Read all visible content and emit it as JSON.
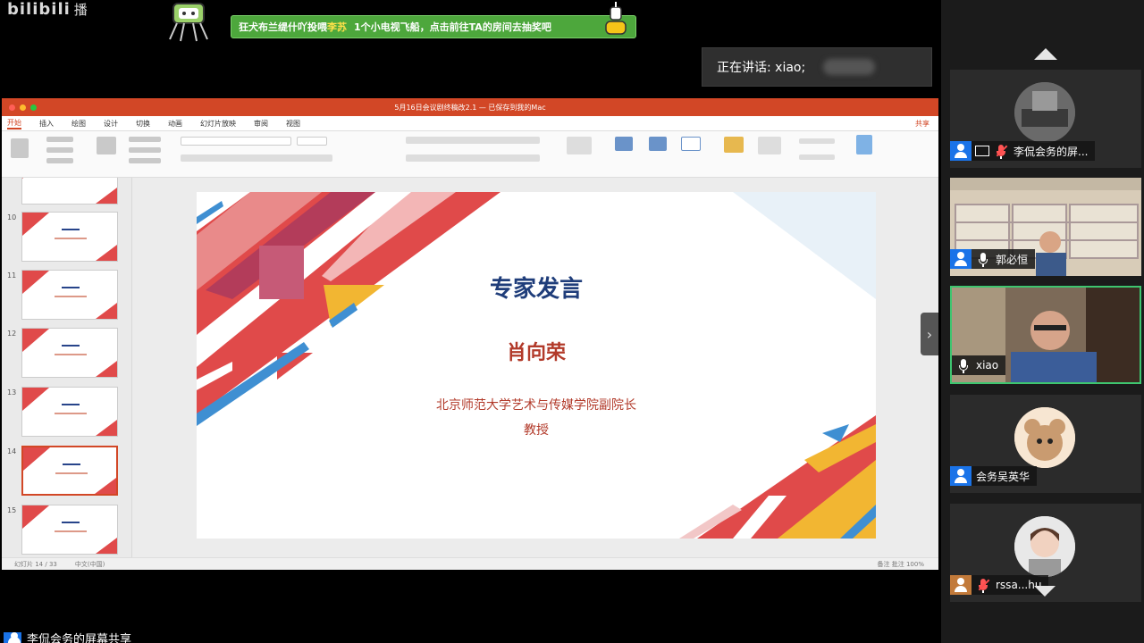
{
  "stream": {
    "logo_text": "bilibili",
    "logo_sub": "播",
    "banner_part1": "狂犬布兰缇什吖投喂",
    "banner_highlight": "李苏",
    "banner_part2": "1个小电视飞船，点击前往TA的房间去抽奖吧"
  },
  "meeting": {
    "speaking_label": "正在讲话: xiao;"
  },
  "keynote": {
    "window_title": "5月16日会议剧终稿改2.1 — 已保存到我的Mac",
    "tabs": [
      "开始",
      "插入",
      "绘图",
      "设计",
      "切换",
      "动画",
      "幻灯片放映",
      "审阅",
      "视图"
    ],
    "share_label": "共享",
    "thumb_numbers": [
      "10",
      "11",
      "12",
      "13",
      "14",
      "15"
    ],
    "status_left": "幻灯片 14 / 33",
    "status_lang": "中文(中国)",
    "status_right": "备注   批注        100%",
    "slide": {
      "title": "专家发言",
      "name": "肖向荣",
      "affiliation": "北京师范大学艺术与传媒学院副院长",
      "position": "教授"
    }
  },
  "participants": [
    {
      "name": "李侃会务的屏..."
    },
    {
      "name": "郭必恒"
    },
    {
      "name": "xiao"
    },
    {
      "name": "会务吴英华"
    },
    {
      "name": "rssa...hu"
    }
  ],
  "bottom": {
    "label": "李侃会务的屏幕共享"
  },
  "colors": {
    "keynote_accent": "#d24726",
    "slide_title": "#1f3d7a",
    "slide_red": "#b23a2a",
    "active_speaker_border": "#3ec56f",
    "banner_bg": "#4da73c"
  }
}
